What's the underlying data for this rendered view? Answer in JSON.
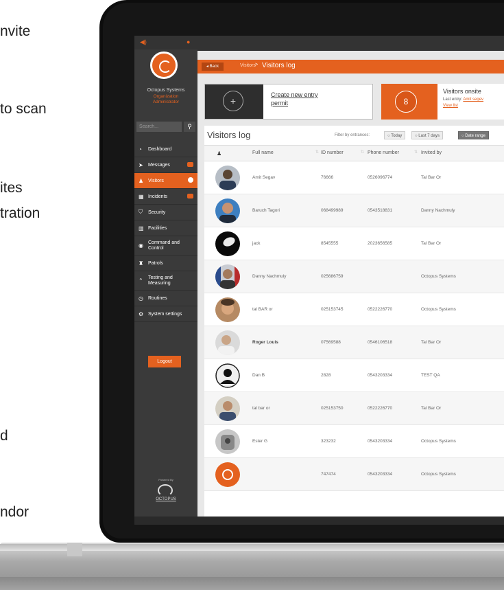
{
  "left_text": [
    "nvite",
    "to scan",
    "ites",
    "tration",
    "d",
    "ndor"
  ],
  "colors": {
    "accent": "#e4611f",
    "sidebar": "#3a3a3a"
  },
  "sidebar": {
    "org_name": "Octopus Systems",
    "org_role_1": "Organization",
    "org_role_2": "Administrator",
    "search_placeholder": "Search...",
    "nav": [
      {
        "label": "Dashboard",
        "icon": "dashboard-icon"
      },
      {
        "label": "Messages",
        "icon": "paper-plane-icon",
        "badge": true
      },
      {
        "label": "Visitors",
        "icon": "visitors-icon",
        "badge": true,
        "active": true
      },
      {
        "label": "Incidents",
        "icon": "calendar-icon",
        "badge": true
      },
      {
        "label": "Security",
        "icon": "shield-icon"
      },
      {
        "label": "Facilities",
        "icon": "building-icon"
      },
      {
        "label": "Command and Control",
        "icon": "eye-icon"
      },
      {
        "label": "Patrols",
        "icon": "patrol-icon"
      },
      {
        "label": "Testing and Measuring",
        "icon": "chart-icon"
      },
      {
        "label": "Routines",
        "icon": "clock-icon"
      },
      {
        "label": "System settings",
        "icon": "gear-icon"
      }
    ],
    "logout_label": "Logout",
    "powered_by": "Powered By",
    "brand": "OCTOPUS"
  },
  "breadcrumb": {
    "back": "Back",
    "parent": "Visitors",
    "sep": ">",
    "current": "Visitors log"
  },
  "create_card": {
    "icon": "+",
    "label": "Create new entry permit"
  },
  "onsite_card": {
    "count": "8",
    "title": "Visitors onsite",
    "last_entry_label": "Last entry:",
    "last_entry_name": "Amit segev",
    "view_list": "View list"
  },
  "log": {
    "title": "Visitors log",
    "filter_label": "Filter by entrances:",
    "filters": [
      "Today",
      "Last 7 days",
      "Date range"
    ],
    "columns": [
      "Full name",
      "ID number",
      "Phone number",
      "Invited by"
    ],
    "rows": [
      {
        "name": "Amit Segav",
        "id": "76666",
        "phone": "0526096774",
        "invited": "Tal Bar Or"
      },
      {
        "name": "Baruch Tagori",
        "id": "068499989",
        "phone": "0543518831",
        "invited": "Danny Nachmuly"
      },
      {
        "name": "jack",
        "id": "8545555",
        "phone": "2023656585",
        "invited": "Tal Bar Or"
      },
      {
        "name": "Danny Nachmuly",
        "id": "025686759",
        "phone": "",
        "invited": "Octopus Systems"
      },
      {
        "name": "tal BAR or",
        "id": "025153745",
        "phone": "0522226770",
        "invited": "Octopus Systems"
      },
      {
        "name": "Roger Louis",
        "id": "07569588",
        "phone": "0546106518",
        "invited": "Tal Bar Or"
      },
      {
        "name": "Dan B",
        "id": "2828",
        "phone": "0543203334",
        "invited": "TEST QA"
      },
      {
        "name": "tal bar or",
        "id": "025153750",
        "phone": "0522226770",
        "invited": "Tal Bar Or"
      },
      {
        "name": "Ester G",
        "id": "323232",
        "phone": "0543203334",
        "invited": "Octopus Systems"
      },
      {
        "name": "",
        "id": "747474",
        "phone": "0543203334",
        "invited": "Octopus Systems"
      }
    ]
  }
}
